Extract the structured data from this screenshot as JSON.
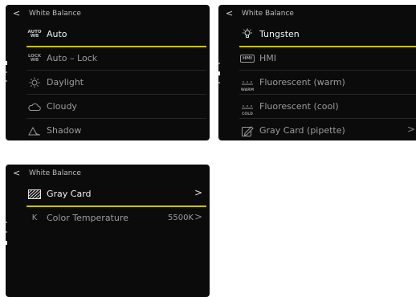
{
  "screens": [
    {
      "back": "<",
      "title": "White Balance",
      "rows": [
        {
          "icon": "auto-wb-icon",
          "icon_text": [
            "AUTO",
            "WB"
          ],
          "label": "Auto",
          "selected": true
        },
        {
          "icon": "lock-wb-icon",
          "icon_text": [
            "LOCK",
            "WB"
          ],
          "label": "Auto – Lock",
          "selected": false
        },
        {
          "icon": "sun-icon",
          "label": "Daylight",
          "selected": false
        },
        {
          "icon": "cloud-icon",
          "label": "Cloudy",
          "selected": false
        },
        {
          "icon": "shadow-icon",
          "label": "Shadow",
          "selected": false
        }
      ]
    },
    {
      "back": "<",
      "title": "White Balance",
      "rows": [
        {
          "icon": "bulb-icon",
          "label": "Tungsten",
          "selected": true
        },
        {
          "icon": "hmi-icon",
          "icon_text": [
            "HMI"
          ],
          "label": "HMI",
          "selected": false
        },
        {
          "icon": "fluorescent-warm-icon",
          "icon_text": [
            "WARM"
          ],
          "label": "Fluorescent (warm)",
          "selected": false
        },
        {
          "icon": "fluorescent-cool-icon",
          "icon_text": [
            "COLD"
          ],
          "label": "Fluorescent (cool)",
          "selected": false
        },
        {
          "icon": "pipette-icon",
          "label": "Gray Card (pipette)",
          "chevron": ">",
          "selected": false
        }
      ]
    },
    {
      "back": "<",
      "title": "White Balance",
      "rows": [
        {
          "icon": "gray-card-icon",
          "label": "Gray Card",
          "chevron": ">",
          "selected": true
        },
        {
          "icon": "kelvin-icon",
          "icon_text": [
            "K"
          ],
          "label": "Color Temperature",
          "value": "5500K",
          "chevron": ">",
          "selected": false
        }
      ]
    }
  ],
  "colors": {
    "accent": "#c8c400",
    "background": "#0b0b0b"
  }
}
